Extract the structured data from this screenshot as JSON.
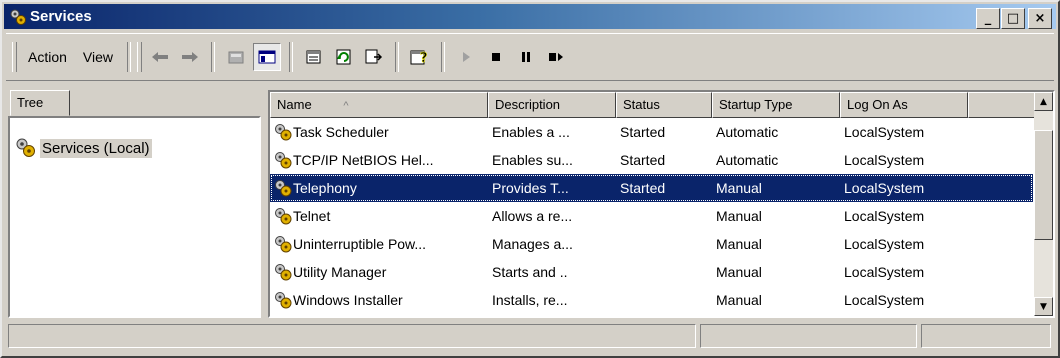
{
  "window": {
    "title": "Services"
  },
  "title_buttons": {
    "minimize": "_",
    "maximize": "□",
    "close": "×"
  },
  "menu": {
    "action_label": "Action",
    "view_label": "View"
  },
  "toolbar_icons": [
    "back-icon",
    "forward-icon",
    "up-icon",
    "show-hide-tree-icon",
    "properties-icon",
    "refresh-icon",
    "export-list-icon",
    "help-icon",
    "play-icon",
    "stop-icon",
    "pause-icon",
    "restart-icon"
  ],
  "tree": {
    "tab_label": "Tree",
    "root_label": "Services (Local)"
  },
  "list": {
    "columns": [
      {
        "label": "Name",
        "sort_indicator": "^"
      },
      {
        "label": "Description"
      },
      {
        "label": "Status"
      },
      {
        "label": "Startup Type"
      },
      {
        "label": "Log On As"
      }
    ],
    "rows": [
      {
        "name": "Task Scheduler",
        "description": "Enables a ...",
        "status": "Started",
        "startup": "Automatic",
        "logon": "LocalSystem",
        "selected": false
      },
      {
        "name": "TCP/IP NetBIOS Hel...",
        "description": "Enables su...",
        "status": "Started",
        "startup": "Automatic",
        "logon": "LocalSystem",
        "selected": false
      },
      {
        "name": "Telephony",
        "description": "Provides T...",
        "status": "Started",
        "startup": "Manual",
        "logon": "LocalSystem",
        "selected": true
      },
      {
        "name": "Telnet",
        "description": "Allows a re...",
        "status": "",
        "startup": "Manual",
        "logon": "LocalSystem",
        "selected": false
      },
      {
        "name": "Uninterruptible Pow...",
        "description": "Manages a...",
        "status": "",
        "startup": "Manual",
        "logon": "LocalSystem",
        "selected": false
      },
      {
        "name": "Utility Manager",
        "description": "Starts and ..",
        "status": "",
        "startup": "Manual",
        "logon": "LocalSystem",
        "selected": false
      },
      {
        "name": "Windows Installer",
        "description": "Installs, re...",
        "status": "",
        "startup": "Manual",
        "logon": "LocalSystem",
        "selected": false
      }
    ]
  },
  "colors": {
    "selection": "#0a246a",
    "face": "#d4d0c8",
    "title_start": "#0a246a",
    "title_end": "#a6caf0"
  }
}
